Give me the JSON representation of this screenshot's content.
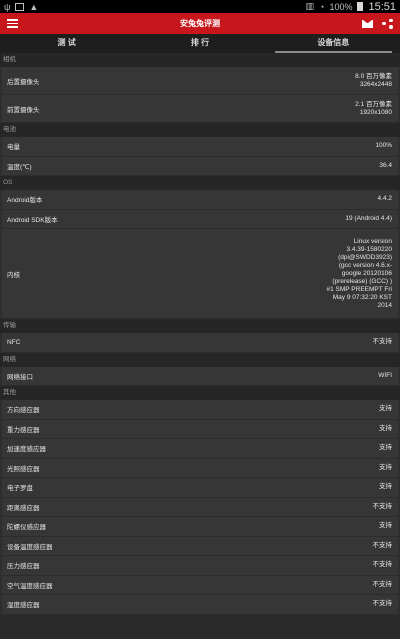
{
  "status_bar": {
    "time": "15:51",
    "battery_percent": "100%"
  },
  "app_bar": {
    "title": "安兔兔评测"
  },
  "tabs": [
    {
      "label": "测 试",
      "active": false
    },
    {
      "label": "排 行",
      "active": false
    },
    {
      "label": "设备信息",
      "active": true
    }
  ],
  "sections": {
    "camera": {
      "title": "相机",
      "rows": [
        {
          "label": "后置摄像头",
          "value_lines": [
            "8.0 百万像素",
            "3264x2448"
          ]
        },
        {
          "label": "前置摄像头",
          "value_lines": [
            "2.1 百万像素",
            "1920x1080"
          ]
        }
      ]
    },
    "battery": {
      "title": "电池",
      "rows": [
        {
          "label": "电量",
          "value": "100%"
        },
        {
          "label": "温度(℃)",
          "value": "36.4"
        }
      ]
    },
    "os": {
      "title": "OS",
      "rows": [
        {
          "label": "Android版本",
          "value": "4.4.2"
        },
        {
          "label": "Android SDK版本",
          "value": "19  (Android 4.4)"
        },
        {
          "label": "内核",
          "value_lines": [
            "Linux version",
            "3.4.39-1580220",
            "(dpi@SWDD3923)",
            "(gcc version 4.6.x-",
            "google 20120106",
            "(prerelease) (GCC) )",
            "#1 SMP PREEMPT Fri",
            "May 9 07:32:20 KST",
            "2014"
          ]
        }
      ]
    },
    "transfer": {
      "title": "传输",
      "rows": [
        {
          "label": "NFC",
          "value": "不支持"
        }
      ]
    },
    "network": {
      "title": "网络",
      "rows": [
        {
          "label": "网络接口",
          "value": "WIFI"
        }
      ]
    },
    "other": {
      "title": "其他",
      "rows": [
        {
          "label": "方向感应器",
          "value": "支持"
        },
        {
          "label": "重力感应器",
          "value": "支持"
        },
        {
          "label": "加速度感应器",
          "value": "支持"
        },
        {
          "label": "光照感应器",
          "value": "支持"
        },
        {
          "label": "电子罗盘",
          "value": "支持"
        },
        {
          "label": "距离感应器",
          "value": "不支持"
        },
        {
          "label": "陀螺仪感应器",
          "value": "支持"
        },
        {
          "label": "设备温度感应器",
          "value": "不支持"
        },
        {
          "label": "压力感应器",
          "value": "不支持"
        },
        {
          "label": "空气温度感应器",
          "value": "不支持"
        },
        {
          "label": "湿度感应器",
          "value": "不支持"
        }
      ]
    }
  }
}
